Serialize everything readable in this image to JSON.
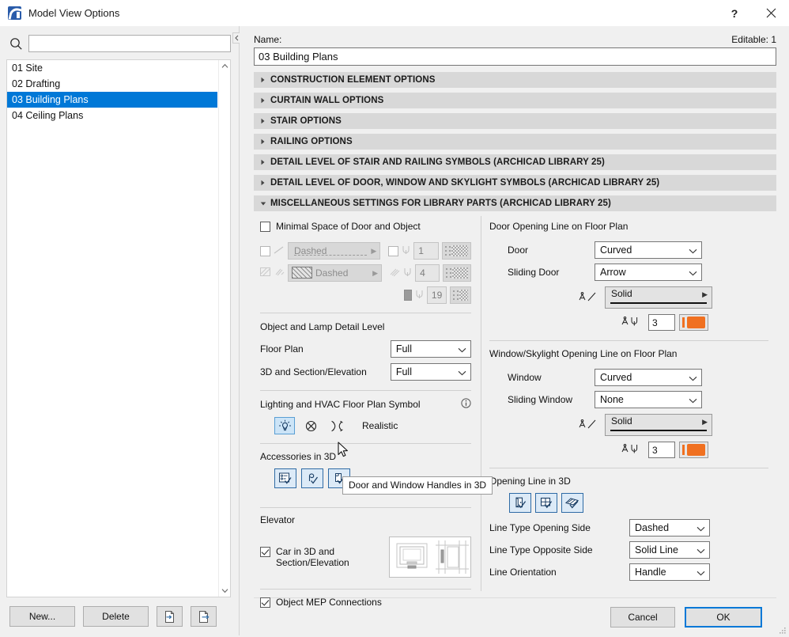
{
  "window": {
    "title": "Model View Options",
    "app_icon": "archicad-icon",
    "help_button": "?",
    "close_button": "✕"
  },
  "sidebar": {
    "search": {
      "placeholder": "",
      "value": "",
      "icon": "search-icon"
    },
    "items": [
      {
        "label": "01 Site",
        "selected": false
      },
      {
        "label": "02 Drafting",
        "selected": false
      },
      {
        "label": "03 Building Plans",
        "selected": true
      },
      {
        "label": "04 Ceiling Plans",
        "selected": false
      }
    ],
    "footer": {
      "new_label": "New...",
      "delete_label": "Delete",
      "import_icon": "import-icon",
      "export_icon": "export-icon"
    }
  },
  "main": {
    "name_label": "Name:",
    "editable_label": "Editable: 1",
    "name_value": "03 Building Plans",
    "sections": [
      {
        "title": "CONSTRUCTION ELEMENT OPTIONS",
        "expanded": false
      },
      {
        "title": "CURTAIN WALL OPTIONS",
        "expanded": false
      },
      {
        "title": "STAIR OPTIONS",
        "expanded": false
      },
      {
        "title": "RAILING OPTIONS",
        "expanded": false
      },
      {
        "title": "DETAIL LEVEL OF STAIR AND RAILING SYMBOLS (ARCHICAD LIBRARY 25)",
        "expanded": false
      },
      {
        "title": "DETAIL LEVEL OF DOOR, WINDOW AND SKYLIGHT SYMBOLS (ARCHICAD LIBRARY 25)",
        "expanded": false
      },
      {
        "title": "MISCELLANEOUS SETTINGS FOR LIBRARY PARTS (ARCHICAD LIBRARY 25)",
        "expanded": true
      }
    ]
  },
  "misc_left": {
    "minimal_space_label": "Minimal Space of Door and Object",
    "minimal_space_checked": false,
    "line_row": {
      "linetype": "Dashed",
      "pen": "1"
    },
    "fill_row": {
      "fill": "Dashed",
      "pen": "4"
    },
    "bg_row": {
      "pen": "19"
    },
    "detail_group_label": "Object and Lamp Detail Level",
    "floor_plan_label": "Floor Plan",
    "floor_plan_value": "Full",
    "3d_section_label": "3D and Section/Elevation",
    "3d_section_value": "Full",
    "lighting_label": "Lighting and HVAC Floor Plan Symbol",
    "lighting_info_icon": "info-icon",
    "lighting_options": [
      {
        "icon": "lamp-realistic-icon",
        "selected": true
      },
      {
        "icon": "crossed-circle-icon",
        "selected": false
      },
      {
        "icon": "lens-symbol-icon",
        "selected": false
      }
    ],
    "lighting_value": "Realistic",
    "accessories_label": "Accessories in 3D",
    "accessories": [
      {
        "icon": "object-accessories-icon",
        "on": true
      },
      {
        "icon": "railing-accessories-icon",
        "on": true
      },
      {
        "icon": "door-window-handles-icon",
        "on": true
      }
    ],
    "elevator_label": "Elevator",
    "car_label_line1": "Car in 3D and",
    "car_label_line2": "Section/Elevation",
    "car_checked": true,
    "elevator_preview_icon": "elevator-preview-image",
    "mep_label": "Object MEP Connections",
    "mep_checked": true,
    "tooltip": "Door and Window Handles in 3D"
  },
  "misc_right": {
    "door_group_label": "Door Opening Line on Floor Plan",
    "door_label": "Door",
    "door_value": "Curved",
    "sliding_door_label": "Sliding Door",
    "sliding_door_value": "Arrow",
    "door_linetype_value": "Solid",
    "door_pen": "3",
    "door_pen_color": "#f07020",
    "window_group_label": "Window/Skylight Opening Line on Floor Plan",
    "window_label": "Window",
    "window_value": "Curved",
    "sliding_window_label": "Sliding Window",
    "sliding_window_value": "None",
    "window_linetype_value": "Solid",
    "window_pen": "3",
    "window_pen_color": "#f07020",
    "opening3d_group_label": "Opening Line in 3D",
    "opening3d_toggles": [
      {
        "icon": "door-3d-icon",
        "on": true
      },
      {
        "icon": "window-3d-icon",
        "on": true
      },
      {
        "icon": "skylight-3d-icon",
        "on": true
      }
    ],
    "lt_opening_label": "Line Type Opening Side",
    "lt_opening_value": "Dashed",
    "lt_opposite_label": "Line Type Opposite Side",
    "lt_opposite_value": "Solid Line",
    "orientation_label": "Line Orientation",
    "orientation_value": "Handle"
  },
  "dialog_buttons": {
    "cancel": "Cancel",
    "ok": "OK"
  }
}
